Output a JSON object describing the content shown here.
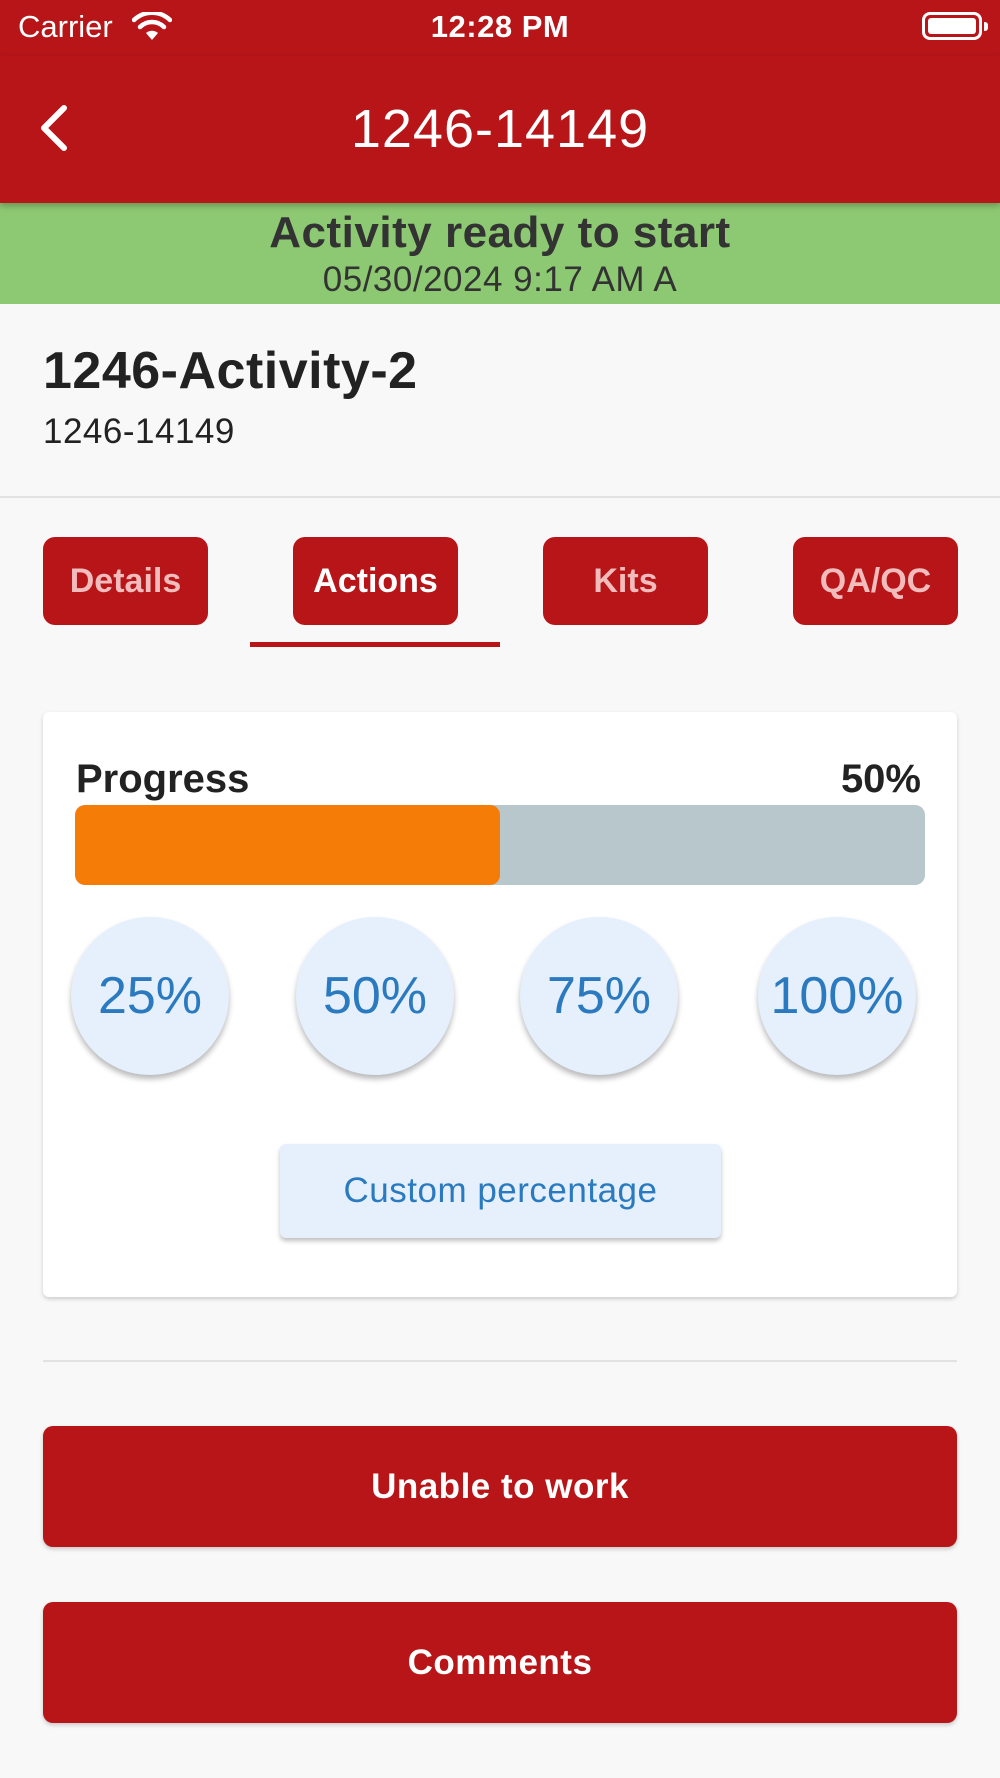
{
  "status_bar": {
    "carrier": "Carrier",
    "time": "12:28 PM",
    "wifi_icon": "wifi-icon",
    "battery_icon": "battery-full-icon"
  },
  "app_bar": {
    "title": "1246-14149",
    "back_icon": "chevron-left-icon"
  },
  "banner": {
    "title": "Activity ready to start",
    "subtitle": "05/30/2024 9:17 AM A",
    "color": "#8dc972"
  },
  "activity": {
    "name": "1246-Activity-2",
    "code": "1246-14149"
  },
  "tabs": [
    {
      "label": "Details",
      "active": false
    },
    {
      "label": "Actions",
      "active": true
    },
    {
      "label": "Kits",
      "active": false
    },
    {
      "label": "QA/QC",
      "active": false
    }
  ],
  "progress": {
    "label": "Progress",
    "value_text": "50%",
    "value": 0.5,
    "fill_color": "#f57c06",
    "track_color": "#b7c7cc",
    "quick_options": [
      "25%",
      "50%",
      "75%",
      "100%"
    ],
    "custom_label": "Custom percentage"
  },
  "actions": {
    "unable_label": "Unable to work",
    "comments_label": "Comments"
  },
  "colors": {
    "primary": "#b71518",
    "accent_blue": "#2b7ac0"
  }
}
